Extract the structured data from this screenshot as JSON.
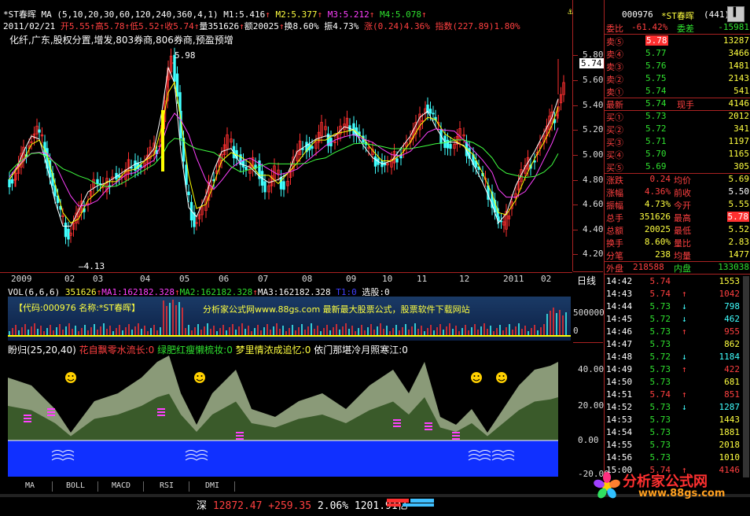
{
  "header": {
    "symbol": "*ST春晖",
    "ma_label": "MA (5,10,20,30,60,120,240,360,4,1)",
    "m1": "M1:5.416",
    "m2": "M2:5.377",
    "m3": "M3:5.212",
    "m4": "M4:5.078",
    "date": "2011/02/21",
    "open": "开5.55",
    "high": "高5.78",
    "low": "低5.52",
    "close": "收5.74",
    "vol": "量351626",
    "amount": "额20025",
    "turnover": "换8.60%",
    "amplitude": "振4.73%",
    "change": "涨(0.24)4.36%",
    "index": "指数(227.89)1.80%",
    "tags": "化纤,广东,股权分置,增发,803券商,806券商,预盈预增"
  },
  "price_axis": [
    "5.80",
    "5.60",
    "5.40",
    "5.20",
    "5.00",
    "4.80",
    "4.60",
    "4.40",
    "4.20"
  ],
  "price_marker": "5.74",
  "low_label": "4.13",
  "high_label": "5.98",
  "time_axis": [
    "2009",
    "02",
    "03",
    "04",
    "05",
    "06",
    "07",
    "08",
    "09",
    "10",
    "11",
    "12",
    "2011",
    "02"
  ],
  "day_line_label": "日线",
  "vol": {
    "label": "VOL(6,6,6)",
    "v": "351626",
    "ma1": "MA1:162182.328",
    "ma2": "MA2:162182.328",
    "ma3": "MA3:162182.328",
    "t1": "T1:0",
    "pick": "选股:0",
    "code_line": "【代码:000976  名称:*ST春晖】",
    "promo": "分析家公式网www.88gs.com 最新最大股票公式，股票软件下载网站",
    "axis": [
      "500000",
      "0"
    ]
  },
  "ind": {
    "name": "盼归(25,20,40)",
    "l1": "花自飘零水流长:0",
    "l2": "绿肥红瘦懒梳妆:0",
    "l3": "梦里情浓成追忆:0",
    "l4": "依门那堪冷月照寒江:0",
    "axis": [
      "40.00",
      "20.00",
      "0.00",
      "-20.00"
    ]
  },
  "buttons": [
    "MA",
    "BOLL",
    "MACD",
    "RSI",
    "DMI"
  ],
  "status": {
    "market": "深",
    "index": "12872.47",
    "chg": "+259.35",
    "pct": "2.06%",
    "amount": "1201.91亿"
  },
  "panel": {
    "code": "000976",
    "name": "*ST春晖",
    "num": "(441)",
    "webi_label": "委比",
    "webi": "-61.42%",
    "weicha_label": "委差",
    "weicha": "-15981",
    "asks": [
      {
        "label": "卖⑤",
        "price": "5.78",
        "vol": "13287"
      },
      {
        "label": "卖④",
        "price": "5.77",
        "vol": "3466"
      },
      {
        "label": "卖③",
        "price": "5.76",
        "vol": "1481"
      },
      {
        "label": "卖②",
        "price": "5.75",
        "vol": "2143"
      },
      {
        "label": "卖①",
        "price": "5.74",
        "vol": "541"
      }
    ],
    "latest_label": "最新",
    "latest": "5.74",
    "hand_label": "现手",
    "hand": "4146",
    "bids": [
      {
        "label": "买①",
        "price": "5.73",
        "vol": "2012"
      },
      {
        "label": "买②",
        "price": "5.72",
        "vol": "341"
      },
      {
        "label": "买③",
        "price": "5.71",
        "vol": "1197"
      },
      {
        "label": "买④",
        "price": "5.70",
        "vol": "1165"
      },
      {
        "label": "买⑤",
        "price": "5.69",
        "vol": "305"
      }
    ],
    "stats": [
      {
        "l1": "涨跌",
        "v1": "0.24",
        "l2": "均价",
        "v2": "5.69"
      },
      {
        "l1": "涨幅",
        "v1": "4.36%",
        "l2": "前收",
        "v2": "5.50"
      },
      {
        "l1": "振幅",
        "v1": "4.73%",
        "l2": "今开",
        "v2": "5.55"
      },
      {
        "l1": "总手",
        "v1": "351626",
        "l2": "最高",
        "v2": "5.78"
      },
      {
        "l1": "总额",
        "v1": "20025",
        "l2": "最低",
        "v2": "5.52"
      },
      {
        "l1": "换手",
        "v1": "8.60%",
        "l2": "量比",
        "v2": "2.83"
      },
      {
        "l1": "分笔",
        "v1": "238",
        "l2": "均量",
        "v2": "1477"
      }
    ],
    "outer_label": "外盘",
    "outer": "218588",
    "inner_label": "内盘",
    "inner": "133038",
    "ticks": [
      {
        "t": "14:42",
        "p": "5.74",
        "a": "",
        "v": "1553"
      },
      {
        "t": "14:43",
        "p": "5.74",
        "a": "↑",
        "v": "1042"
      },
      {
        "t": "14:44",
        "p": "5.73",
        "a": "↓",
        "v": "798"
      },
      {
        "t": "14:45",
        "p": "5.72",
        "a": "↓",
        "v": "462"
      },
      {
        "t": "14:46",
        "p": "5.73",
        "a": "↑",
        "v": "955"
      },
      {
        "t": "14:47",
        "p": "5.73",
        "a": "",
        "v": "862"
      },
      {
        "t": "14:48",
        "p": "5.72",
        "a": "↓",
        "v": "1184"
      },
      {
        "t": "14:49",
        "p": "5.73",
        "a": "↑",
        "v": "422"
      },
      {
        "t": "14:50",
        "p": "5.73",
        "a": "",
        "v": "681"
      },
      {
        "t": "14:51",
        "p": "5.74",
        "a": "↑",
        "v": "851"
      },
      {
        "t": "14:52",
        "p": "5.73",
        "a": "↓",
        "v": "1287"
      },
      {
        "t": "14:53",
        "p": "5.73",
        "a": "",
        "v": "1443"
      },
      {
        "t": "14:54",
        "p": "5.73",
        "a": "",
        "v": "1881"
      },
      {
        "t": "14:55",
        "p": "5.73",
        "a": "",
        "v": "2018"
      },
      {
        "t": "14:56",
        "p": "5.73",
        "a": "",
        "v": "1010"
      },
      {
        "t": "15:00",
        "p": "5.74",
        "a": "↑",
        "v": "4146"
      }
    ]
  },
  "watermark": {
    "name": "分析家公式网",
    "url": "www.88gs.com"
  },
  "colors": {
    "up": "#ff3030",
    "down": "#40ffff",
    "bg": "#000000",
    "ma1": "#ffffff",
    "ma2": "#ffff00",
    "ma3": "#ff00ff",
    "ma4": "#00ff00"
  }
}
